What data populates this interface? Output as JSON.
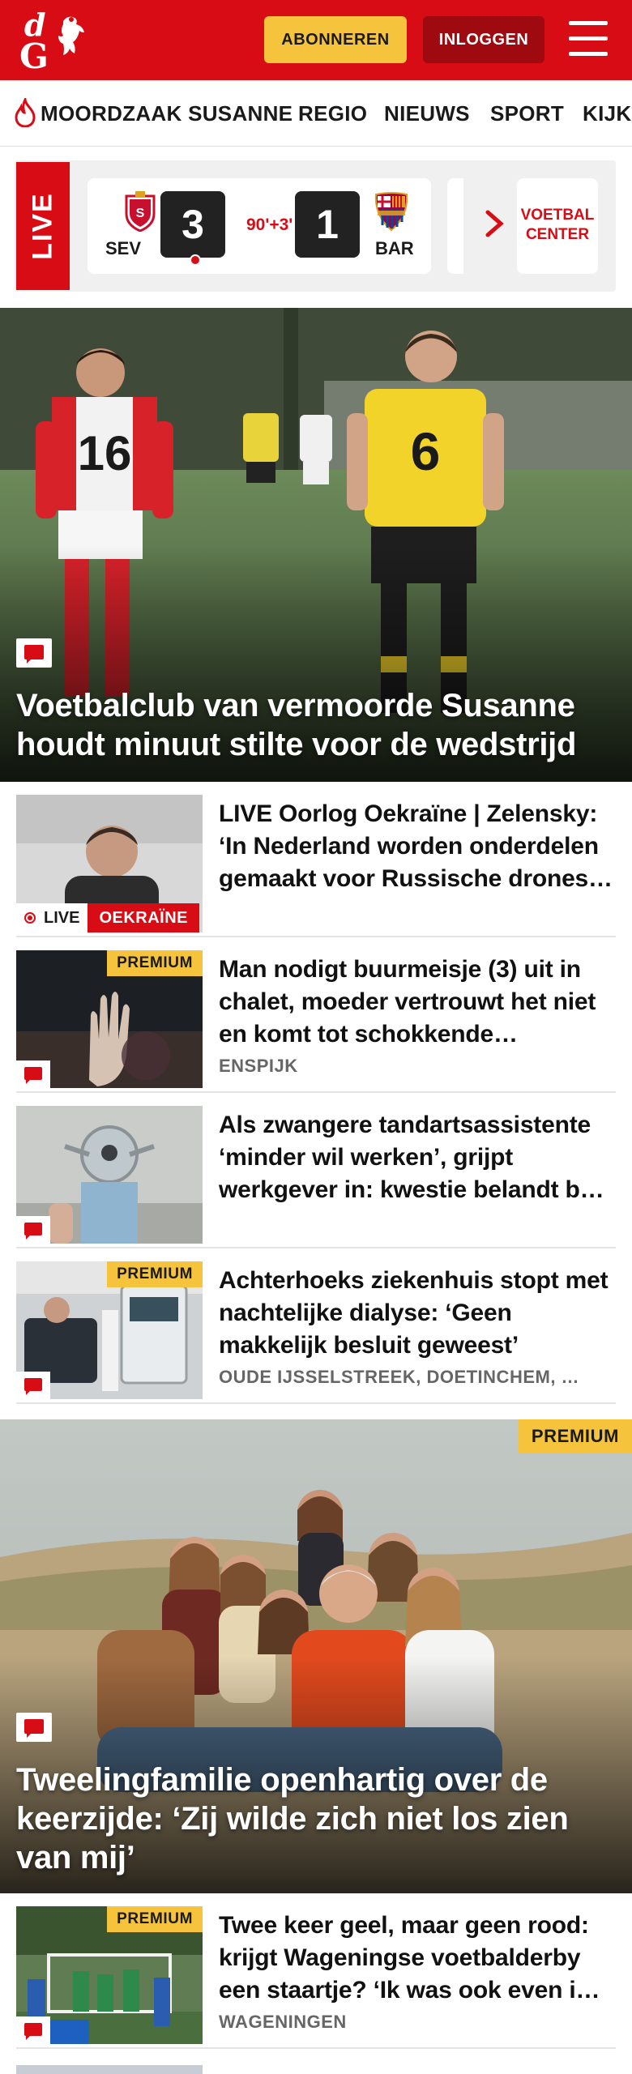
{
  "header": {
    "logo_alt": "dG",
    "subscribe_label": "ABONNEREN",
    "login_label": "INLOGGEN",
    "brand_color": "#d80c14",
    "subscribe_color": "#f6c43c"
  },
  "nav": {
    "items": [
      {
        "label": "MOORDZAAK SUSANNE",
        "icon": "flame-icon"
      },
      {
        "label": "REGIO"
      },
      {
        "label": "NIEUWS"
      },
      {
        "label": "SPORT"
      },
      {
        "label": "KIJK"
      }
    ]
  },
  "live_scores": {
    "live_label": "LIVE",
    "match": {
      "home_team": "SEV",
      "away_team": "BAR",
      "home_score": "3",
      "away_score": "1",
      "minute": "90'+3'"
    },
    "cta_label_1": "VOETBAL",
    "cta_label_2": "CENTER"
  },
  "hero": {
    "title": "Voetbalclub van vermoorde Susanne houdt minuut stilte voor de wedstrijd"
  },
  "articles": [
    {
      "title": "LIVE Oorlog Oekraïne | Zelensky: ‘In Nederland worden onderdelen gemaakt voor Russische drones…",
      "live_label": "LIVE",
      "topic_label": "OEKRAÏNE"
    },
    {
      "title": "Man nodigt buurmeisje (3) uit in chalet, moeder vertrouwt het niet en komt tot schokkende…",
      "meta": "ENSPIJK",
      "premium": "PREMIUM"
    },
    {
      "title": "Als zwangere tandartsassistente ‘minder wil werken’, grijpt werkgever in: kwestie belandt b…"
    },
    {
      "title": "Achterhoeks ziekenhuis stopt met nachtelijke dialyse: ‘Geen makkelijk besluit geweest’",
      "meta": "OUDE IJSSELSTREEK, DOETINCHEM, …",
      "premium": "PREMIUM"
    },
    {
      "title": "Twee keer geel, maar geen rood: krijgt Wageningse voetbalderby een staartje? ‘Ik was ook even i…",
      "meta": "WAGENINGEN",
      "premium": "PREMIUM"
    }
  ],
  "feature": {
    "title": "Tweelingfamilie openhartig over de keerzijde: ‘Zij wilde zich niet los zien van mij’",
    "premium": "PREMIUM"
  }
}
